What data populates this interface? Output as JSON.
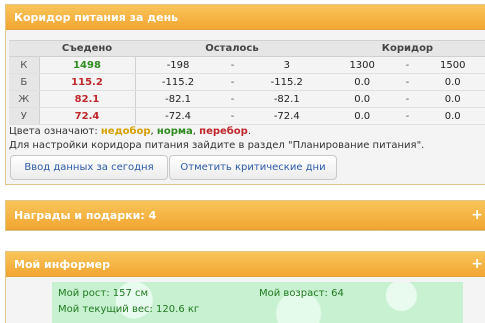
{
  "corridor_panel": {
    "title": "Коридор питания за день",
    "columns": {
      "eaten": "Съедено",
      "remaining": "Осталось",
      "corridor": "Коридор"
    },
    "rows": [
      {
        "label": "К",
        "eaten": "1498",
        "eaten_color": "#2e8b1e",
        "rem_from": "-198",
        "rem_sep": "-",
        "rem_to": "3",
        "cor_from": "1300",
        "cor_sep": "-",
        "cor_to": "1500"
      },
      {
        "label": "Б",
        "eaten": "115.2",
        "eaten_color": "#c0262b",
        "rem_from": "-115.2",
        "rem_sep": "-",
        "rem_to": "-115.2",
        "cor_from": "0.0",
        "cor_sep": "-",
        "cor_to": "0.0"
      },
      {
        "label": "Ж",
        "eaten": "82.1",
        "eaten_color": "#c0262b",
        "rem_from": "-82.1",
        "rem_sep": "-",
        "rem_to": "-82.1",
        "cor_from": "0.0",
        "cor_sep": "-",
        "cor_to": "0.0"
      },
      {
        "label": "У",
        "eaten": "72.4",
        "eaten_color": "#c0262b",
        "rem_from": "-72.4",
        "rem_sep": "-",
        "rem_to": "-72.4",
        "cor_from": "0.0",
        "cor_sep": "-",
        "cor_to": "0.0"
      }
    ],
    "legend": {
      "prefix": "Цвета означают:",
      "under": "недобор",
      "comma1": ",",
      "norm": "норма",
      "comma2": ",",
      "over": "перебор",
      "dot": "."
    },
    "note": "Для настройки коридора питания зайдите в раздел \"Планирование питания\".",
    "buttons": {
      "today": "Ввод данных за сегодня",
      "critical": "Отметить критические дни"
    }
  },
  "rewards_panel": {
    "title": "Награды и подарки: 4",
    "expand": "+"
  },
  "informer_panel": {
    "title": "Мой информер",
    "expand": "+",
    "height": "Мой рост: 157 см",
    "age": "Мой возраст: 64",
    "weight": "Мой текущий вес: 120.6 кг"
  },
  "colors": {
    "accent": "#f2a632",
    "norm": "#2e8b1e",
    "over": "#c0262b",
    "under": "#d6a000",
    "link": "#2a5aa8"
  }
}
